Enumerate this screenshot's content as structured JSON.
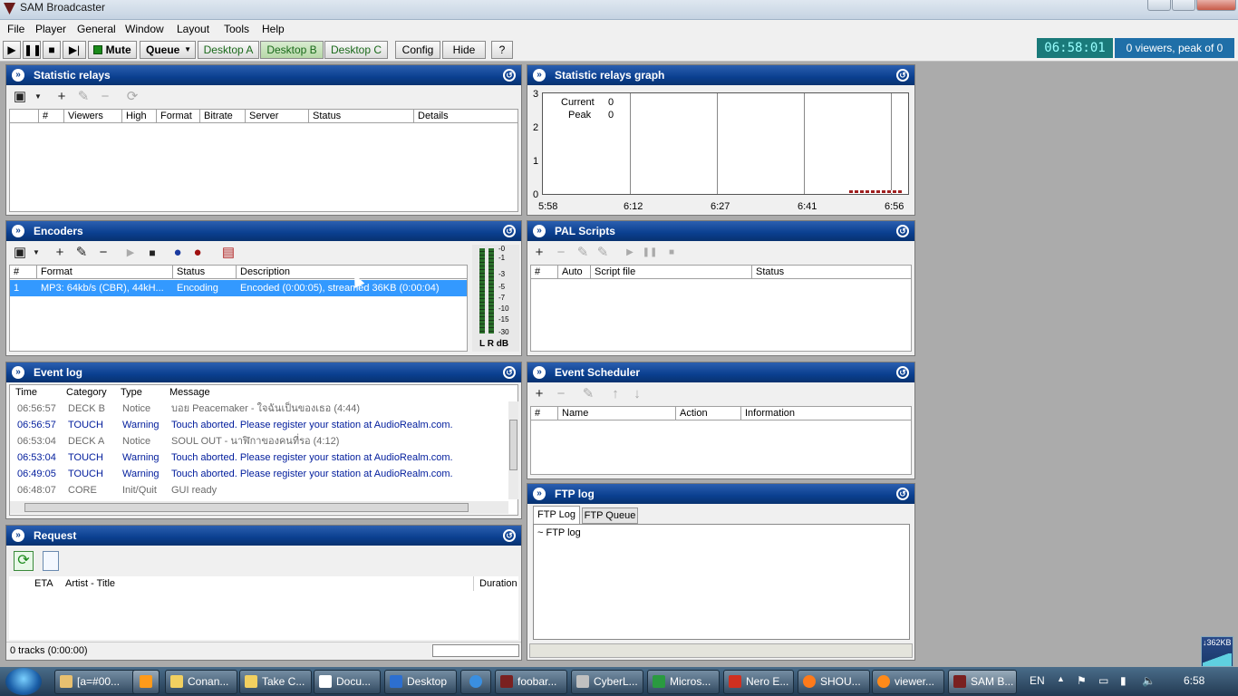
{
  "window": {
    "title": "SAM Broadcaster"
  },
  "menu": [
    "File",
    "Player",
    "General",
    "Window",
    "Layout",
    "Tools",
    "Help"
  ],
  "toolbar": {
    "mute": "Mute",
    "queue": "Queue",
    "desktop_a": "Desktop A",
    "desktop_b": "Desktop B",
    "desktop_c": "Desktop C",
    "config": "Config",
    "hide": "Hide",
    "help": "?",
    "clock": "06:58:01",
    "viewers": "0 viewers, peak of 0"
  },
  "statistic_relays": {
    "title": "Statistic relays",
    "columns": [
      "#",
      "Viewers",
      "High",
      "Format",
      "Bitrate",
      "Server",
      "Status",
      "Details"
    ]
  },
  "relays_graph": {
    "title": "Statistic relays graph",
    "legend": [
      {
        "label": "Current",
        "value": "0"
      },
      {
        "label": "Peak",
        "value": "0"
      }
    ],
    "y_ticks": [
      "3",
      "2",
      "1",
      "0"
    ],
    "x_ticks": [
      "5:58",
      "6:12",
      "6:27",
      "6:41",
      "6:56"
    ]
  },
  "encoders": {
    "title": "Encoders",
    "columns": [
      "#",
      "Format",
      "Status",
      "Description"
    ],
    "rows": [
      {
        "num": "1",
        "format": "MP3: 64kb/s (CBR), 44kH...",
        "status": "Encoding",
        "description": "Encoded (0:00:05), streamed 36KB (0:00:04)"
      }
    ],
    "vu_scale": [
      "-0",
      "-1",
      "-3",
      "-5",
      "-7",
      "-10",
      "-15",
      "-30"
    ],
    "vu_labels": "L R dB"
  },
  "pal_scripts": {
    "title": "PAL Scripts",
    "columns": [
      "#",
      "Auto",
      "Script file",
      "Status"
    ]
  },
  "event_log": {
    "title": "Event log",
    "columns": [
      "Time",
      "Category",
      "Type",
      "Message"
    ],
    "rows": [
      {
        "time": "06:56:57",
        "category": "DECK B",
        "type": "Notice",
        "message": "บอย Peacemaker - ใจฉันเป็นของเธอ (4:44)",
        "kind": "gray"
      },
      {
        "time": "06:56:57",
        "category": "TOUCH",
        "type": "Warning",
        "message": "Touch aborted. Please register your station at AudioRealm.com.",
        "kind": "warn"
      },
      {
        "time": "06:53:04",
        "category": "DECK A",
        "type": "Notice",
        "message": "SOUL OUT - นาฬิกาของคนที่รอ (4:12)",
        "kind": "gray"
      },
      {
        "time": "06:53:04",
        "category": "TOUCH",
        "type": "Warning",
        "message": "Touch aborted. Please register your station at AudioRealm.com.",
        "kind": "warn"
      },
      {
        "time": "06:49:05",
        "category": "TOUCH",
        "type": "Warning",
        "message": "Touch aborted. Please register your station at AudioRealm.com.",
        "kind": "warn"
      },
      {
        "time": "06:48:07",
        "category": "CORE",
        "type": "Init/Quit",
        "message": "GUI ready",
        "kind": "gray"
      }
    ]
  },
  "event_scheduler": {
    "title": "Event Scheduler",
    "columns": [
      "#",
      "Name",
      "Action",
      "Information"
    ]
  },
  "request": {
    "title": "Request",
    "columns": [
      "ETA",
      "Artist - Title",
      "Duration"
    ],
    "status": "0 tracks (0:00:00)"
  },
  "ftp_log": {
    "title": "FTP log",
    "tabs": [
      "FTP Log",
      "FTP Queue"
    ],
    "content": "~ FTP log"
  },
  "net_meter": "↓362KB",
  "taskbar": {
    "items": [
      {
        "label": "[a=#00...",
        "color": "#e8c070"
      },
      {
        "label": "",
        "color": "#ff9a1a"
      },
      {
        "label": "Conan...",
        "color": "#f2d060"
      },
      {
        "label": "Take C...",
        "color": "#f2d060"
      },
      {
        "label": "Docu...",
        "color": "#ffffff"
      },
      {
        "label": "Desktop",
        "color": "#2d6fd0"
      },
      {
        "label": "",
        "color": "#3a8fe0"
      },
      {
        "label": "foobar...",
        "color": "#7a2020"
      },
      {
        "label": "CyberL...",
        "color": "#c0c0c0"
      },
      {
        "label": "Micros...",
        "color": "#2a9a40"
      },
      {
        "label": "Nero E...",
        "color": "#d03020"
      },
      {
        "label": "SHOU...",
        "color": "#ff7a1a"
      },
      {
        "label": "viewer...",
        "color": "#ff8a1a"
      },
      {
        "label": "SAM B...",
        "color": "#7a2020"
      }
    ],
    "lang": "EN",
    "time": "6:58"
  }
}
